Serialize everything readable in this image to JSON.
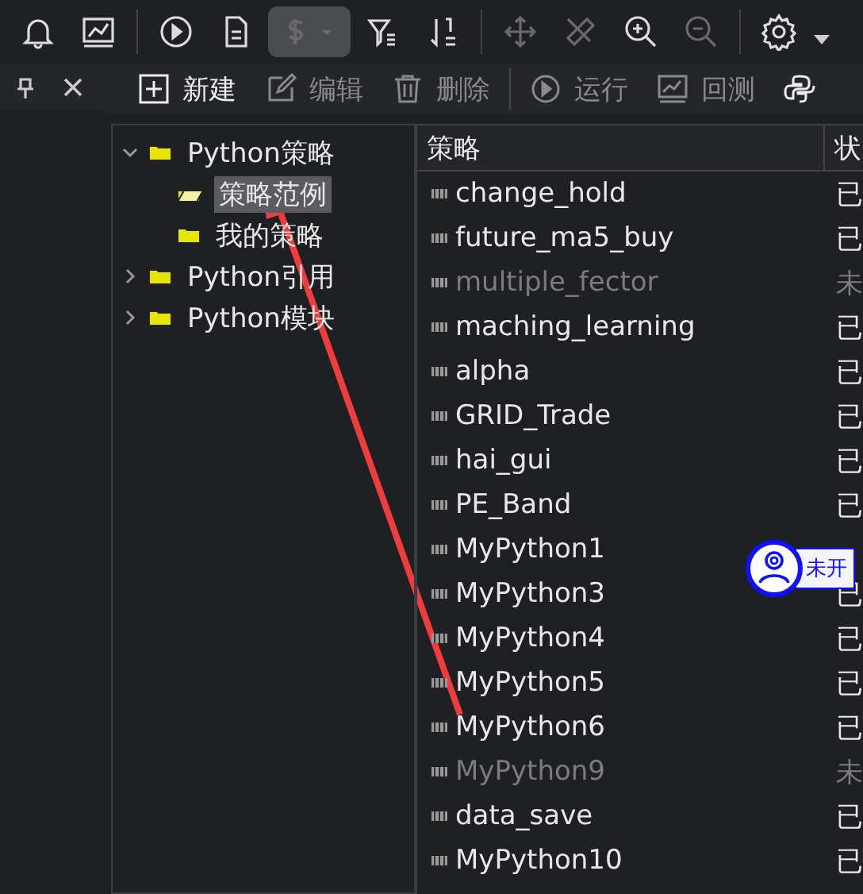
{
  "toolbar": [
    {
      "kind": "bell",
      "disabled": false
    },
    {
      "kind": "chart",
      "disabled": false
    },
    {
      "kind": "sep"
    },
    {
      "kind": "play",
      "disabled": false
    },
    {
      "kind": "doc",
      "disabled": false
    },
    {
      "kind": "dollar",
      "disabled": true
    },
    {
      "kind": "filter",
      "disabled": false
    },
    {
      "kind": "sort",
      "disabled": false
    },
    {
      "kind": "sep"
    },
    {
      "kind": "move",
      "disabled": true
    },
    {
      "kind": "ruler",
      "disabled": true
    },
    {
      "kind": "zoomin",
      "disabled": false
    },
    {
      "kind": "zoomout",
      "disabled": true
    },
    {
      "kind": "sep"
    },
    {
      "kind": "gear",
      "disabled": false
    }
  ],
  "actions": [
    {
      "kind": "new",
      "label": "新建",
      "disabled": false
    },
    {
      "kind": "edit",
      "label": "编辑",
      "disabled": true
    },
    {
      "kind": "delete",
      "label": "删除",
      "disabled": true
    },
    {
      "kind": "run",
      "label": "运行",
      "disabled": true
    },
    {
      "kind": "backtest",
      "label": "回测",
      "disabled": true
    },
    {
      "kind": "python",
      "disabled": false
    }
  ],
  "tree": [
    {
      "label": "Python策略",
      "expanded": true,
      "selected": false,
      "children": [
        {
          "label": "策略范例",
          "selected": true
        },
        {
          "label": "我的策略",
          "selected": false
        }
      ]
    },
    {
      "label": "Python引用",
      "expanded": false,
      "selected": false
    },
    {
      "label": "Python模块",
      "expanded": false,
      "selected": false
    }
  ],
  "table": {
    "columns": [
      "策略",
      "状"
    ],
    "rows": [
      {
        "name": "change_hold",
        "status": "已",
        "enabled": true
      },
      {
        "name": "future_ma5_buy",
        "status": "已",
        "enabled": true
      },
      {
        "name": "multiple_fector",
        "status": "未",
        "enabled": false
      },
      {
        "name": "maching_learning",
        "status": "已",
        "enabled": true
      },
      {
        "name": "alpha",
        "status": "已",
        "enabled": true
      },
      {
        "name": "GRID_Trade",
        "status": "已",
        "enabled": true
      },
      {
        "name": "hai_gui",
        "status": "已",
        "enabled": true
      },
      {
        "name": "PE_Band",
        "status": "已",
        "enabled": true
      },
      {
        "name": "MyPython1",
        "enabled": true
      },
      {
        "name": "MyPython3",
        "status": "已",
        "enabled": true
      },
      {
        "name": "MyPython4",
        "status": "已",
        "enabled": true
      },
      {
        "name": "MyPython5",
        "status": "已",
        "enabled": true
      },
      {
        "name": "MyPython6",
        "status": "已",
        "enabled": true
      },
      {
        "name": "MyPython9",
        "status": "未",
        "enabled": false
      },
      {
        "name": "data_save",
        "status": "已",
        "enabled": true
      },
      {
        "name": "MyPython10",
        "status": "已",
        "enabled": true
      }
    ]
  },
  "floating_badge": {
    "label": "未开"
  }
}
